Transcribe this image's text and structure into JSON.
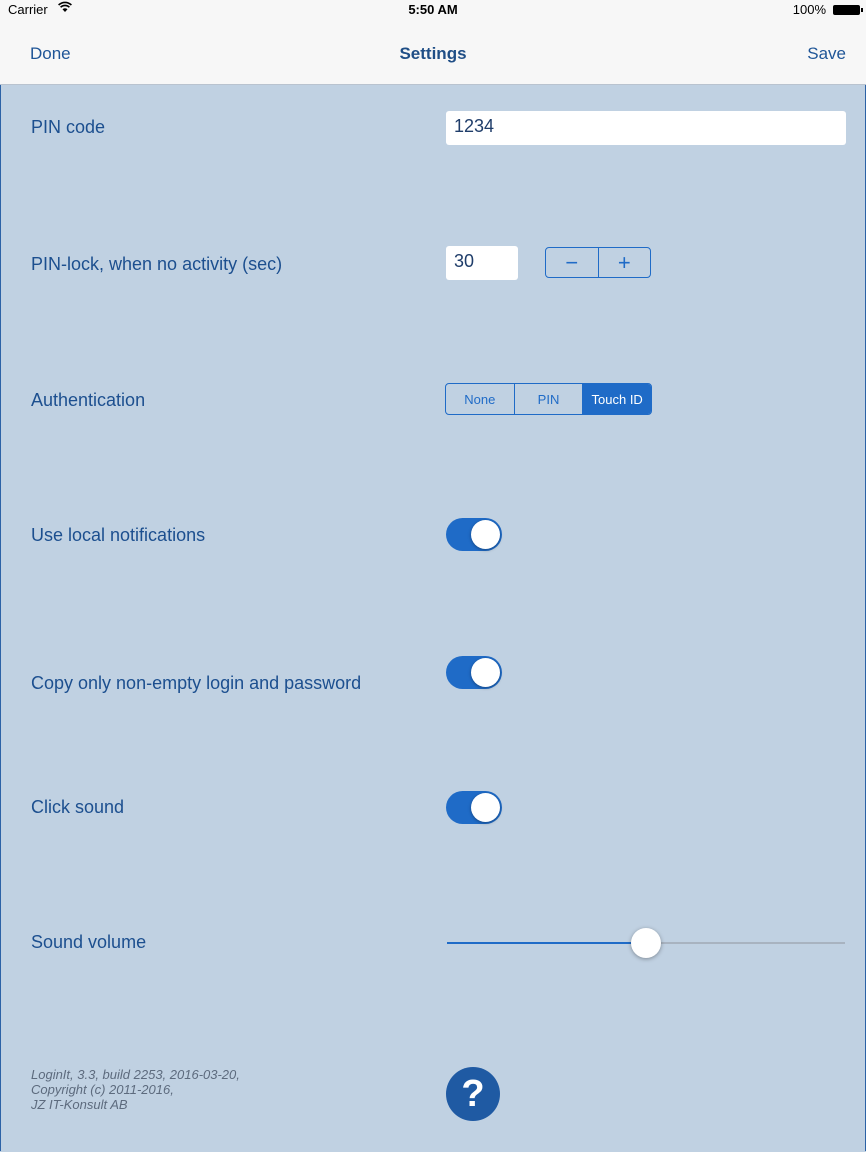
{
  "status_bar": {
    "carrier": "Carrier",
    "wifi_icon": "wifi-icon",
    "time": "5:50 AM",
    "battery_percent": "100%"
  },
  "nav": {
    "left_label": "Done",
    "title": "Settings",
    "right_label": "Save"
  },
  "settings": {
    "pin_code": {
      "label": "PIN code",
      "value": "1234"
    },
    "pin_lock": {
      "label": "PIN-lock, when no activity (sec)",
      "value": "30",
      "minus": "−",
      "plus": "+"
    },
    "authentication": {
      "label": "Authentication",
      "options": [
        "None",
        "PIN",
        "Touch ID"
      ],
      "selected": "Touch ID"
    },
    "local_notifications": {
      "label": "Use local notifications",
      "on": true
    },
    "copy_non_empty": {
      "label": "Copy only non-empty login and password",
      "on": true
    },
    "click_sound": {
      "label": "Click sound",
      "on": true
    },
    "sound_volume": {
      "label": "Sound volume",
      "value": 0.5
    }
  },
  "footer": {
    "lines": [
      "LoginIt, 3.3, build 2253, 2016-03-20,",
      "Copyright (c) 2011-2016,",
      "JZ IT-Konsult AB"
    ],
    "help_icon": "?"
  },
  "colors": {
    "background": "#c0d1e2",
    "accent": "#1f6bc7",
    "label_text": "#1c4f8f"
  }
}
